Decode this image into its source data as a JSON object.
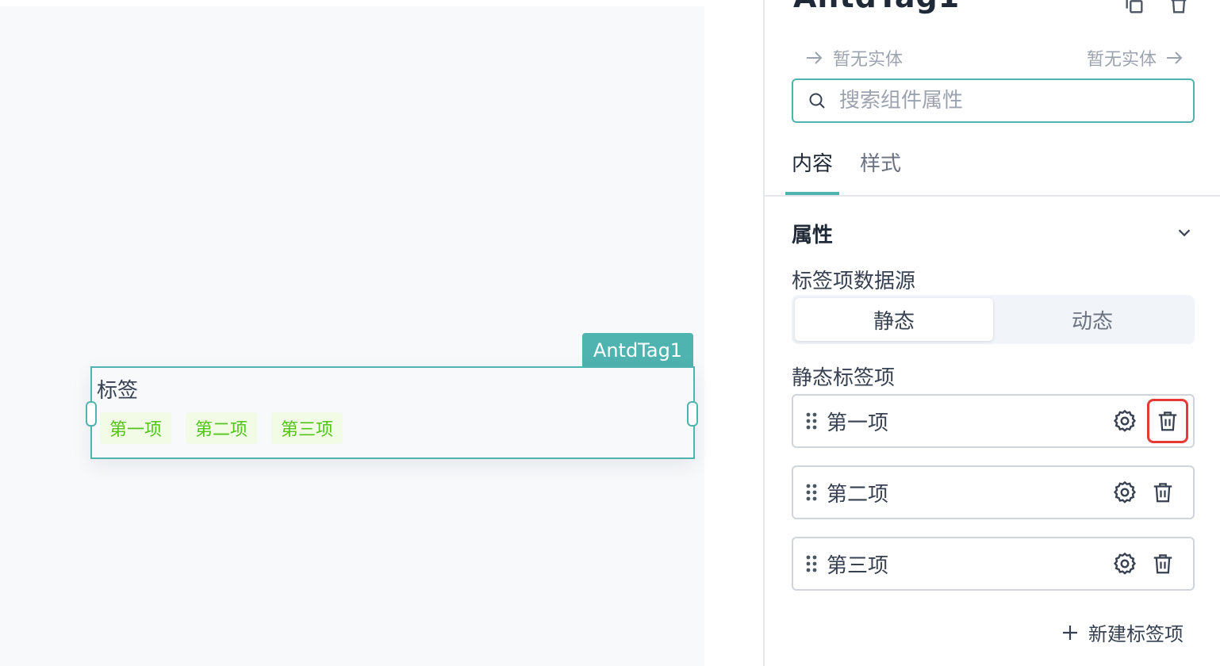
{
  "canvas": {
    "component_label": "AntdTag1",
    "component_title": "标签",
    "tags": [
      "第一项",
      "第二项",
      "第三项"
    ]
  },
  "panel": {
    "title": "AntdTag1",
    "entity_left": "暂无实体",
    "entity_right": "暂无实体",
    "search_placeholder": "搜索组件属性",
    "tabs": [
      {
        "label": "内容",
        "active": true
      },
      {
        "label": "样式",
        "active": false
      }
    ],
    "section_title": "属性",
    "datasource_label": "标签项数据源",
    "datasource_options": [
      {
        "label": "静态",
        "active": true
      },
      {
        "label": "动态",
        "active": false
      }
    ],
    "static_items_label": "静态标签项",
    "items": [
      "第一项",
      "第二项",
      "第三项"
    ],
    "add_item_label": "新建标签项"
  },
  "colors": {
    "accent": "#4fb3b0",
    "tag_text": "#52c41a",
    "tag_bg": "#f1fbe6",
    "highlight": "#e53935"
  },
  "icons": [
    "copy-icon",
    "delete-icon",
    "arrow-right-icon",
    "search-icon",
    "chevron-down-icon",
    "drag-handle-icon",
    "gear-icon",
    "trash-icon",
    "plus-icon"
  ]
}
